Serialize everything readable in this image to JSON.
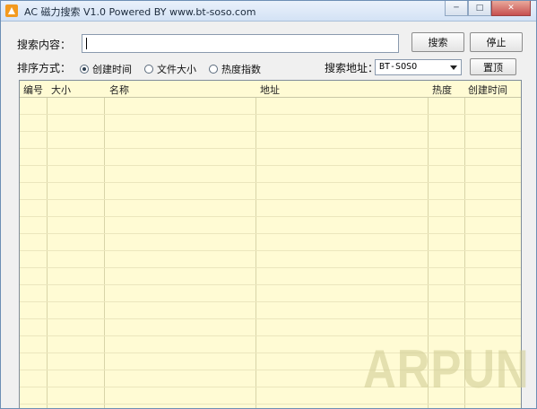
{
  "window": {
    "title": "AC 磁力搜索 V1.0 Powered BY www.bt-soso.com",
    "controls": {
      "minimize": "─",
      "maximize": "□",
      "close": "✕"
    }
  },
  "search": {
    "label": "搜索内容：",
    "value": "",
    "search_button": "搜索",
    "stop_button": "停止"
  },
  "sort": {
    "label": "排序方式：",
    "options": [
      {
        "label": "创建时间",
        "checked": true
      },
      {
        "label": "文件大小",
        "checked": false
      },
      {
        "label": "热度指数",
        "checked": false
      }
    ]
  },
  "source": {
    "label": "搜索地址：",
    "selected": "BT-SOSO",
    "top_button": "置顶"
  },
  "table": {
    "columns": [
      "编号",
      "大小",
      "名称",
      "地址",
      "热度",
      "创建时间"
    ]
  },
  "watermark": "ARPUN"
}
